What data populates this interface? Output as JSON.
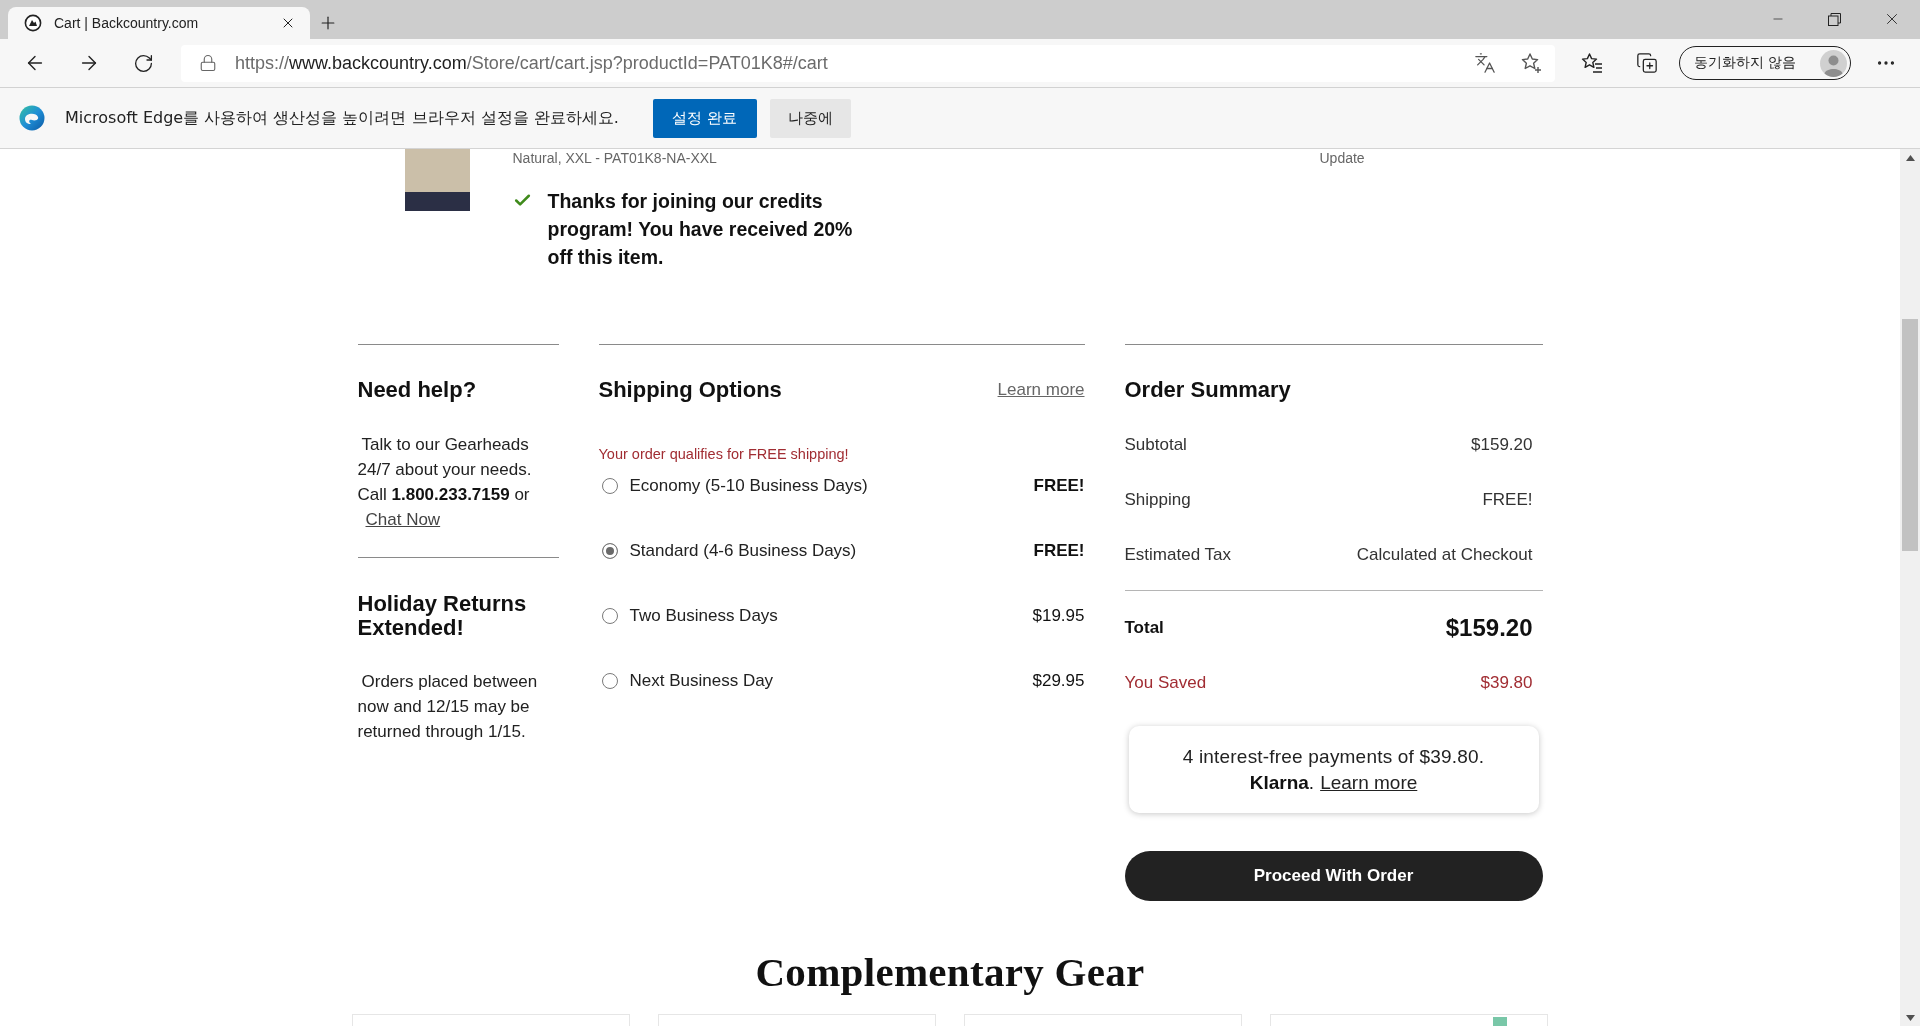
{
  "browser": {
    "tab": {
      "title": "Cart | Backcountry.com"
    },
    "url": {
      "scheme": "https://",
      "host": "www.backcountry.com",
      "path": "/Store/cart/cart.jsp?productId=PAT01K8#/cart"
    },
    "profile_button": "동기화하지 않음"
  },
  "infobar": {
    "message": "Microsoft Edge를 사용하여 생산성을 높이려면 브라우저 설정을 완료하세요.",
    "buttons": [
      {
        "label": "설정 완료",
        "kind": "primary"
      },
      {
        "label": "나중에",
        "kind": "secondary"
      }
    ]
  },
  "product": {
    "variant": "Natural, XXL - PAT01K8-NA-XXL",
    "update_link": "Update",
    "credit_message": "Thanks for joining our credits program! You have received 20% off this item."
  },
  "help": {
    "title": "Need help?",
    "text": "Talk to our Gearheads 24/7 about your needs. Call **1.800.233.7159** or",
    "link": "Chat Now"
  },
  "returns": {
    "title": "Holiday Returns Extended!",
    "text": "Orders placed between now and 12/15 may be returned through 1/15."
  },
  "shipping": {
    "title": "Shipping Options",
    "learn_more": "Learn more",
    "notice": "Your order qualifies for FREE shipping!",
    "options": [
      {
        "label": "Economy (5-10 Business Days)",
        "price": "FREE!",
        "kind": "free",
        "selected": false
      },
      {
        "label": "Standard (4-6 Business Days)",
        "price": "FREE!",
        "kind": "free",
        "selected": true
      },
      {
        "label": "Two Business Days",
        "price": "$19.95",
        "kind": "paid",
        "selected": false
      },
      {
        "label": "Next Business Day",
        "price": "$29.95",
        "kind": "paid",
        "selected": false
      }
    ]
  },
  "summary": {
    "title": "Order Summary",
    "rows": [
      {
        "label": "Subtotal",
        "value": "$159.20"
      },
      {
        "label": "Shipping",
        "value": "FREE!"
      },
      {
        "label": "Estimated Tax",
        "value": "Calculated at Checkout"
      }
    ],
    "totals": [
      {
        "label": "Total",
        "value": "$159.20",
        "kind": "total"
      },
      {
        "label": "You Saved",
        "value": "$39.80",
        "kind": "savings"
      }
    ],
    "klarna": {
      "message": "4 interest-free payments of $39.80.",
      "brand": "**Klarna**.",
      "link": "Learn more"
    },
    "checkout_button": "Proceed With Order"
  },
  "recommendations": {
    "title": "Complementary Gear",
    "cards": [
      {
        "marked": false
      },
      {
        "marked": false
      },
      {
        "marked": false
      },
      {
        "marked": true
      }
    ]
  }
}
